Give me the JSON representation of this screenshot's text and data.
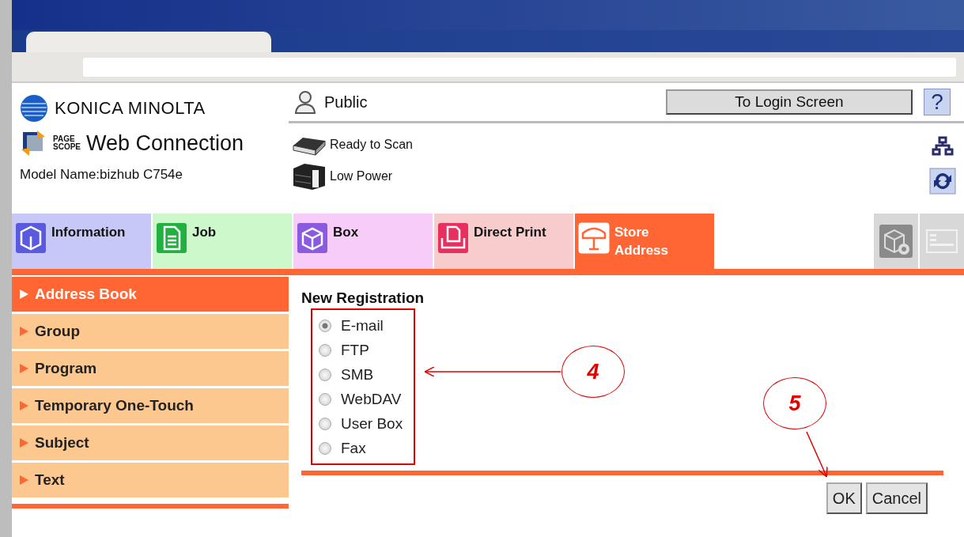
{
  "header": {
    "brand": "KONICA MINOLTA",
    "product_small": "PAGE SCOPE",
    "product": "Web Connection",
    "model": "Model Name:bizhub C754e",
    "user": "Public",
    "login_button": "To Login Screen",
    "help_button": "?",
    "status": [
      {
        "text": "Ready to Scan"
      },
      {
        "text": "Low Power"
      }
    ]
  },
  "tabs": [
    {
      "label": "Information",
      "color": "#c8c8f8",
      "selected": false
    },
    {
      "label": "Job",
      "color": "#ccf8cc",
      "selected": false
    },
    {
      "label": "Box",
      "color": "#f8ccf8",
      "selected": false
    },
    {
      "label": "Direct Print",
      "color": "#f8cccc",
      "selected": false
    },
    {
      "label": "Store Address",
      "color": "#ff6633",
      "selected": true
    }
  ],
  "sidebar": [
    {
      "label": "Address Book",
      "selected": true
    },
    {
      "label": "Group",
      "selected": false
    },
    {
      "label": "Program",
      "selected": false
    },
    {
      "label": "Temporary One-Touch",
      "selected": false
    },
    {
      "label": "Subject",
      "selected": false
    },
    {
      "label": "Text",
      "selected": false
    }
  ],
  "form": {
    "title": "New Registration",
    "options": [
      {
        "label": "E-mail",
        "selected": true
      },
      {
        "label": "FTP",
        "selected": false
      },
      {
        "label": "SMB",
        "selected": false
      },
      {
        "label": "WebDAV",
        "selected": false
      },
      {
        "label": "User Box",
        "selected": false
      },
      {
        "label": "Fax",
        "selected": false
      }
    ],
    "buttons": [
      "OK",
      "Cancel"
    ]
  },
  "callouts": [
    {
      "number": "4"
    },
    {
      "number": "5"
    }
  ]
}
